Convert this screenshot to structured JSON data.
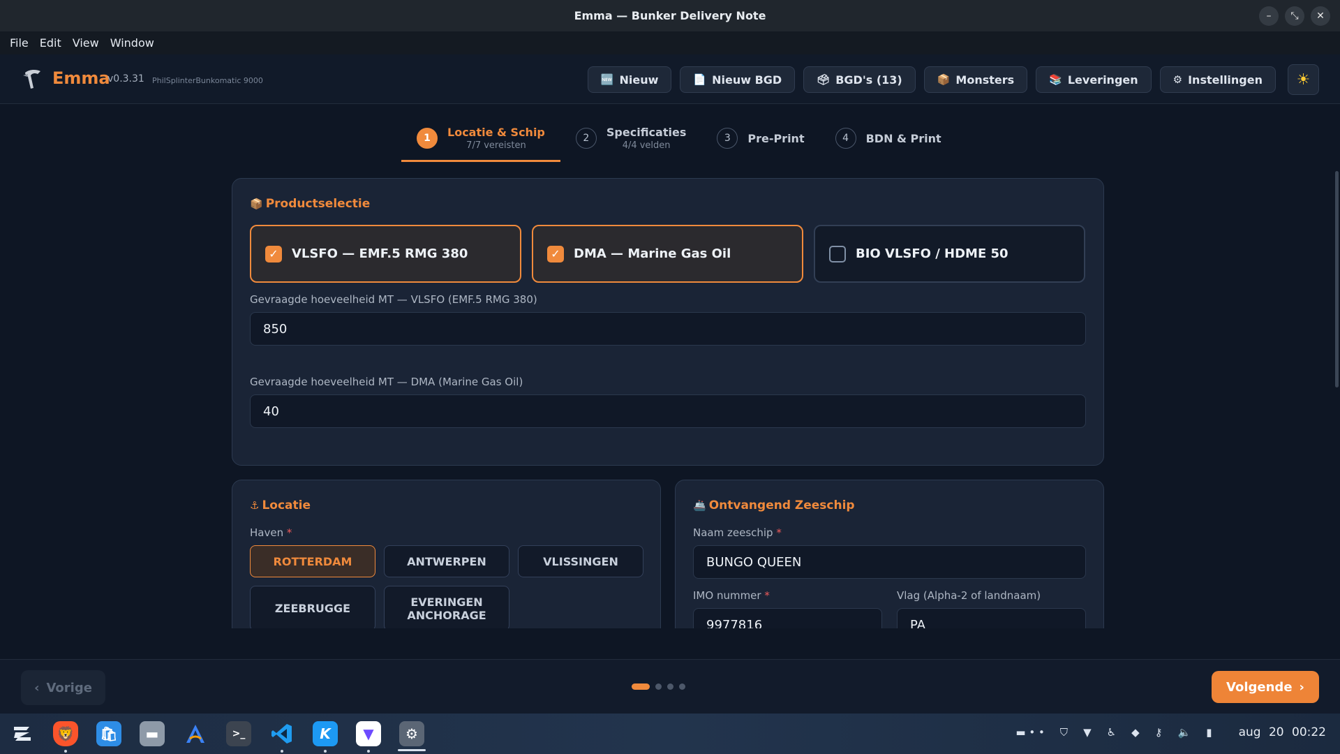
{
  "window": {
    "title": "Emma — Bunker Delivery Note"
  },
  "menu": [
    "File",
    "Edit",
    "View",
    "Window"
  ],
  "header": {
    "brand": "Emma",
    "version": "v0.3.31",
    "tagline": "PhilSplinterBunkomatic 9000",
    "nav": [
      {
        "icon": "🆕",
        "icon_name": "new-icon",
        "label": "Nieuw"
      },
      {
        "icon": "📄",
        "icon_name": "document-icon",
        "label": "Nieuw BGD"
      },
      {
        "icon": "🗳",
        "icon_name": "ballot-box-icon",
        "label": "BGD's (13)"
      },
      {
        "icon": "📦",
        "icon_name": "package-icon",
        "label": "Monsters"
      },
      {
        "icon": "📚",
        "icon_name": "books-icon",
        "label": "Leveringen"
      },
      {
        "icon": "⚙",
        "icon_name": "gear-icon",
        "label": "Instellingen"
      }
    ],
    "theme_icon": "☀"
  },
  "steps": [
    {
      "num": "1",
      "label": "Locatie & Schip",
      "sub": "7/7 vereisten",
      "active": true
    },
    {
      "num": "2",
      "label": "Specificaties",
      "sub": "4/4 velden",
      "active": false
    },
    {
      "num": "3",
      "label": "Pre-Print",
      "sub": "",
      "active": false
    },
    {
      "num": "4",
      "label": "BDN & Print",
      "sub": "",
      "active": false
    }
  ],
  "product": {
    "title": "Productselectie",
    "title_icon": "📦",
    "options": [
      {
        "label": "VLSFO — EMF.5 RMG 380",
        "checked": true
      },
      {
        "label": "DMA — Marine Gas Oil",
        "checked": true
      },
      {
        "label": "BIO VLSFO / HDME 50",
        "checked": false
      }
    ],
    "qty_vlsfo_label": "Gevraagde hoeveelheid MT — VLSFO (EMF.5 RMG 380)",
    "qty_vlsfo_value": "850",
    "qty_dma_label": "Gevraagde hoeveelheid MT — DMA (Marine Gas Oil)",
    "qty_dma_value": "40"
  },
  "location": {
    "title": "Locatie",
    "title_icon": "⚓",
    "port_label": "Haven",
    "ports": [
      "ROTTERDAM",
      "ANTWERPEN",
      "VLISSINGEN",
      "ZEEBRUGGE",
      "EVERINGEN ANCHORAGE"
    ],
    "selected_port": "ROTTERDAM"
  },
  "vessel": {
    "title": "Ontvangend Zeeschip",
    "title_icon": "🚢",
    "name_label": "Naam zeeschip",
    "name_value": "BUNGO QUEEN",
    "imo_label": "IMO nummer",
    "imo_value": "9977816",
    "flag_label": "Vlag (Alpha-2 of landnaam)",
    "flag_value": "PA"
  },
  "footer": {
    "prev_label": "Vorige",
    "next_label": "Volgende",
    "page_count": 4,
    "current_page": 1
  },
  "taskbar": {
    "date": "aug 20",
    "time": "00:22"
  },
  "colors": {
    "accent": "#f08a3c",
    "background": "#0e1624",
    "card": "#1a2436"
  }
}
